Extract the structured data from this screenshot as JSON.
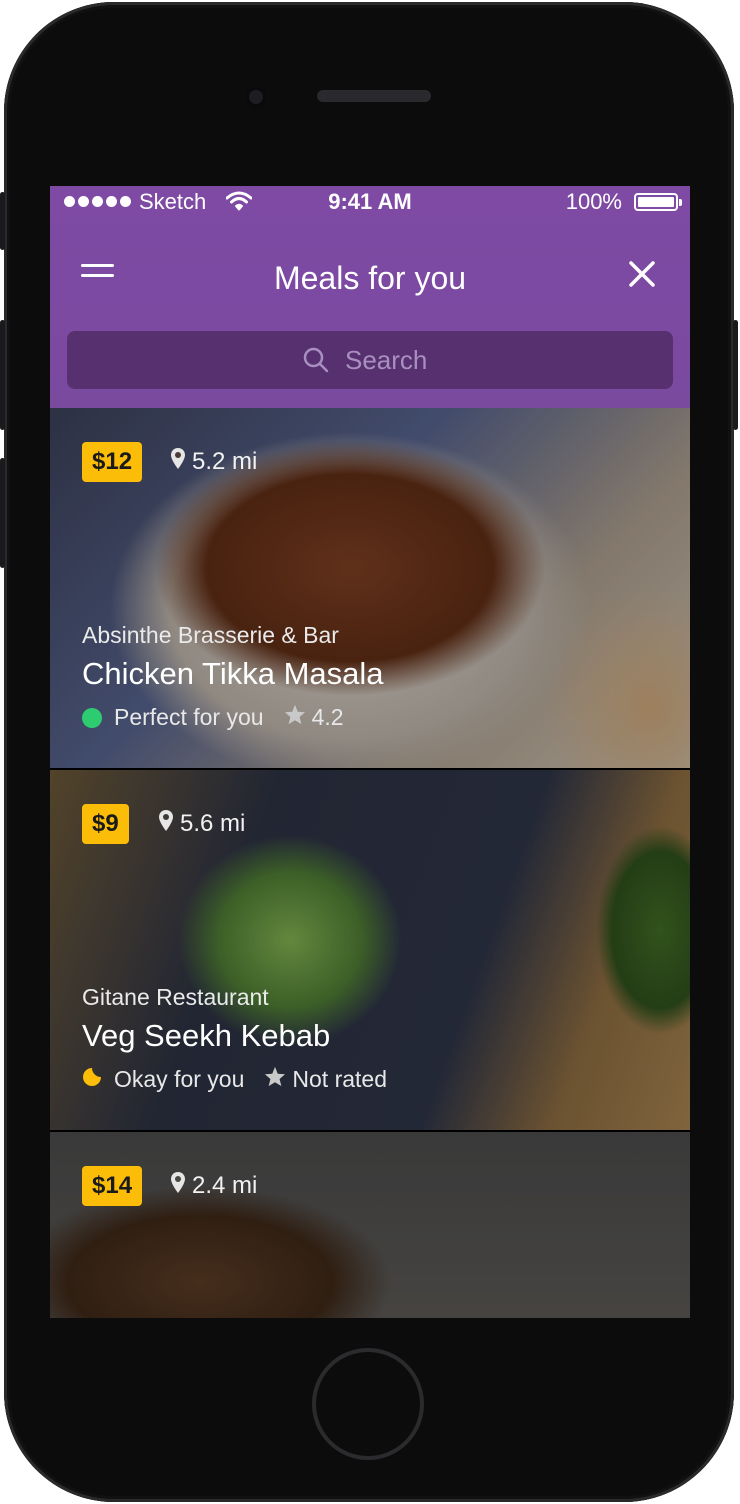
{
  "status_bar": {
    "carrier": "Sketch",
    "time": "9:41 AM",
    "battery": "100%"
  },
  "header": {
    "title": "Meals for you",
    "menu_icon": "hamburger-menu-icon",
    "close_icon": "close-icon"
  },
  "search": {
    "placeholder": "Search"
  },
  "colors": {
    "header_purple": "#7e4aa4",
    "search_bg": "#56306f",
    "price_badge": "#fbbd08",
    "perfect_green": "#2ecc71",
    "okay_amber": "#fbbd08"
  },
  "meals": [
    {
      "price": "$12",
      "distance": "5.2 mi",
      "restaurant": "Absinthe Brasserie & Bar",
      "name": "Chicken Tikka Masala",
      "fit": "Perfect for you",
      "fit_icon": "green-dot-icon",
      "rating": "4.2"
    },
    {
      "price": "$9",
      "distance": "5.6 mi",
      "restaurant": "Gitane Restaurant",
      "name": "Veg Seekh Kebab",
      "fit": "Okay for you",
      "fit_icon": "half-moon-icon",
      "rating": "Not rated"
    },
    {
      "price": "$14",
      "distance": "2.4 mi"
    }
  ]
}
